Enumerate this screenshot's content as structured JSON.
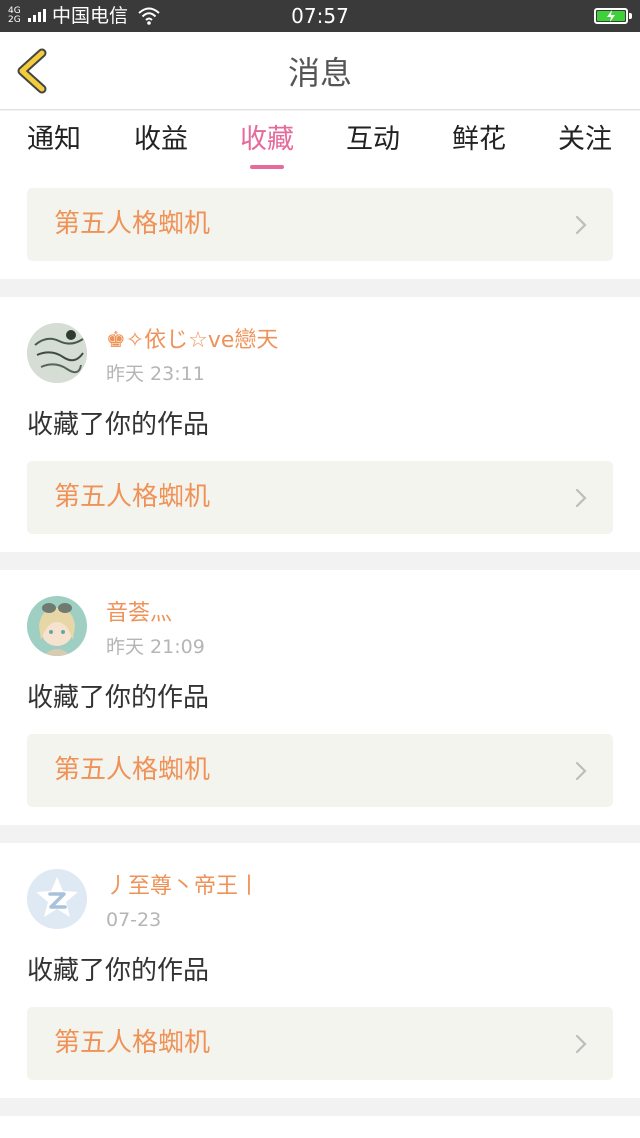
{
  "status_bar": {
    "network": "4G",
    "network2": "2G",
    "carrier": "中国电信",
    "time": "07:57",
    "battery_color": "#3ed13a"
  },
  "header": {
    "back_icon": "chevron-left-icon",
    "title": "消息",
    "accent_color": "#f3cc3c"
  },
  "tabs": {
    "items": [
      {
        "label": "通知"
      },
      {
        "label": "收益"
      },
      {
        "label": "收藏"
      },
      {
        "label": "互动"
      },
      {
        "label": "鲜花"
      },
      {
        "label": "关注"
      }
    ],
    "active_index": 2,
    "active_color": "#e66a9a"
  },
  "top_item": {
    "work_title": "第五人格蜘机"
  },
  "messages": [
    {
      "username": "♚✧依じ☆ve戀天",
      "timestamp": "昨天 23:11",
      "action": "收藏了你的作品",
      "work_title": "第五人格蜘机"
    },
    {
      "username": "音荟灬",
      "timestamp": "昨天 21:09",
      "action": "收藏了你的作品",
      "work_title": "第五人格蜘机"
    },
    {
      "username": "丿至尊丶帝王丨",
      "timestamp": "07-23",
      "action": "收藏了你的作品",
      "work_title": "第五人格蜘机"
    }
  ],
  "colors": {
    "username": "#ef9258",
    "work_title": "#ef9258",
    "timestamp": "#b5b5b5",
    "work_box_bg": "#f4f4ee"
  }
}
